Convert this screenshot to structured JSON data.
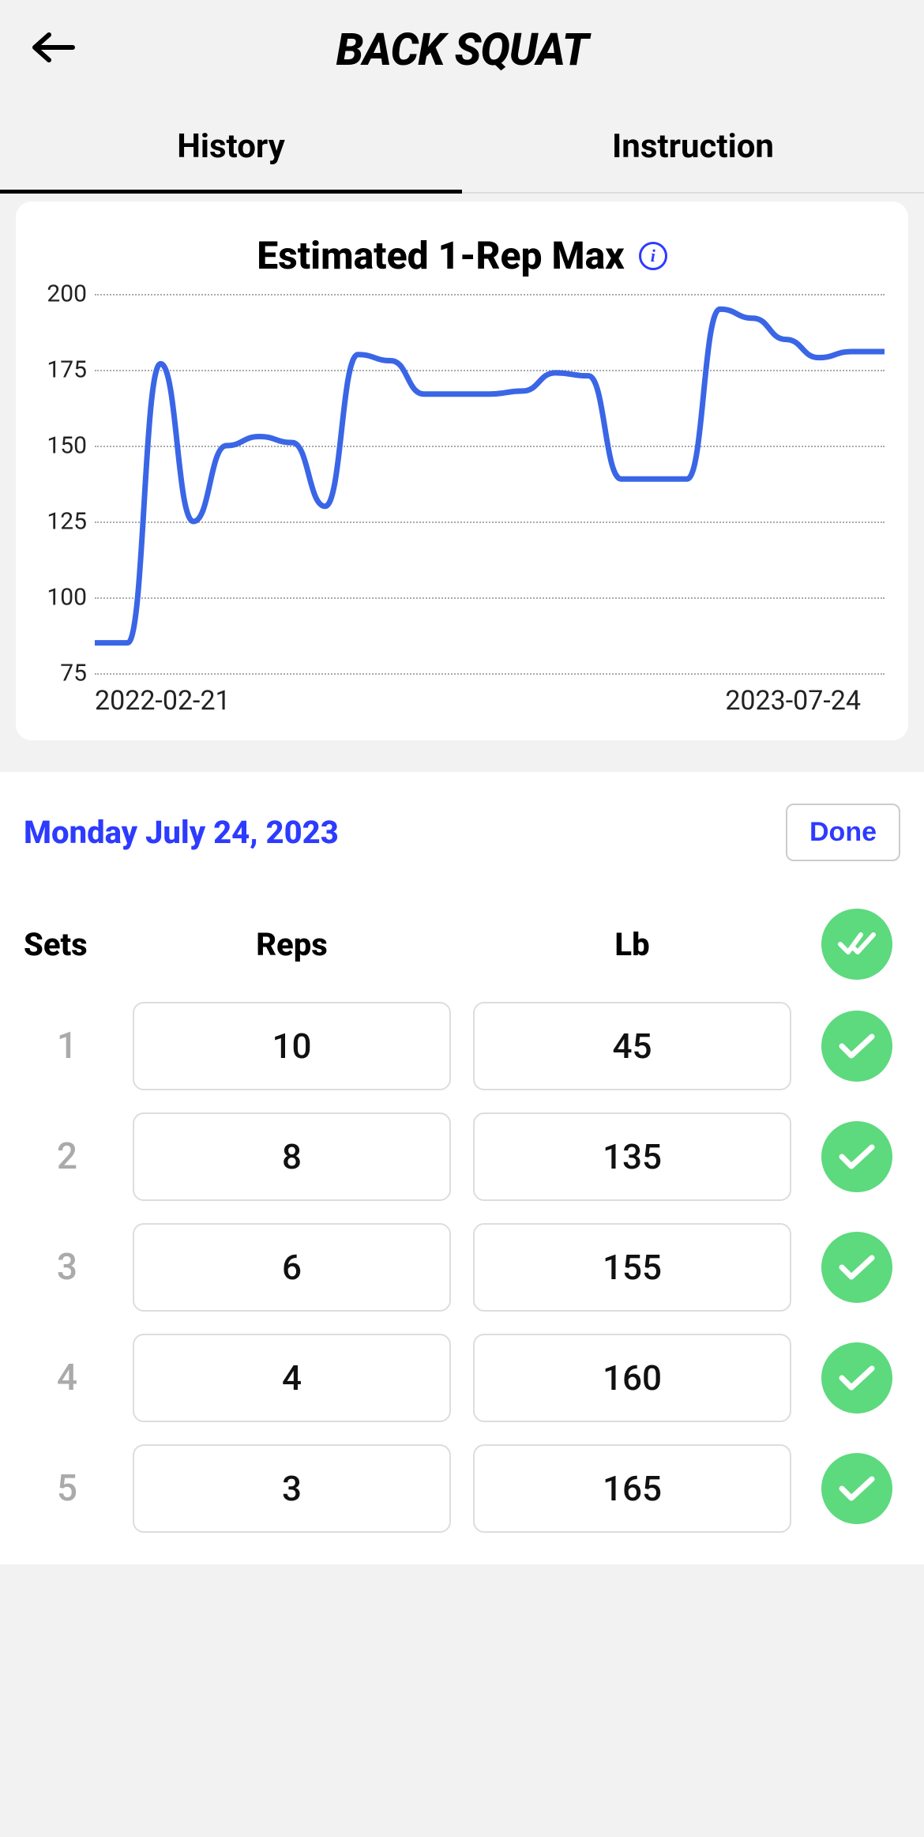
{
  "header": {
    "title": "BACK SQUAT"
  },
  "tabs": {
    "history": "History",
    "instruction": "Instruction",
    "active": "history"
  },
  "chart": {
    "title": "Estimated 1-Rep Max",
    "start_date": "2022-02-21",
    "end_date": "2023-07-24"
  },
  "chart_data": {
    "type": "line",
    "title": "Estimated 1-Rep Max",
    "xlabel": "",
    "ylabel": "",
    "ylim": [
      75,
      200
    ],
    "y_ticks": [
      75,
      100,
      125,
      150,
      175,
      200
    ],
    "x_range": [
      "2022-02-21",
      "2023-07-24"
    ],
    "series": [
      {
        "name": "1RM",
        "values": [
          85,
          85,
          177,
          125,
          150,
          153,
          151,
          130,
          180,
          178,
          167,
          167,
          167,
          168,
          174,
          173,
          139,
          139,
          139,
          195,
          192,
          185,
          179,
          181,
          181
        ]
      }
    ]
  },
  "workout": {
    "date_label": "Monday July 24, 2023",
    "done_label": "Done",
    "columns": {
      "sets": "Sets",
      "reps": "Reps",
      "weight": "Lb"
    },
    "sets": [
      {
        "num": "1",
        "reps": "10",
        "weight": "45",
        "done": true
      },
      {
        "num": "2",
        "reps": "8",
        "weight": "135",
        "done": true
      },
      {
        "num": "3",
        "reps": "6",
        "weight": "155",
        "done": true
      },
      {
        "num": "4",
        "reps": "4",
        "weight": "160",
        "done": true
      },
      {
        "num": "5",
        "reps": "3",
        "weight": "165",
        "done": true
      }
    ]
  },
  "colors": {
    "accent_blue": "#2d3bff",
    "check_green": "#5dd97e",
    "line_blue": "#3a66e6"
  }
}
